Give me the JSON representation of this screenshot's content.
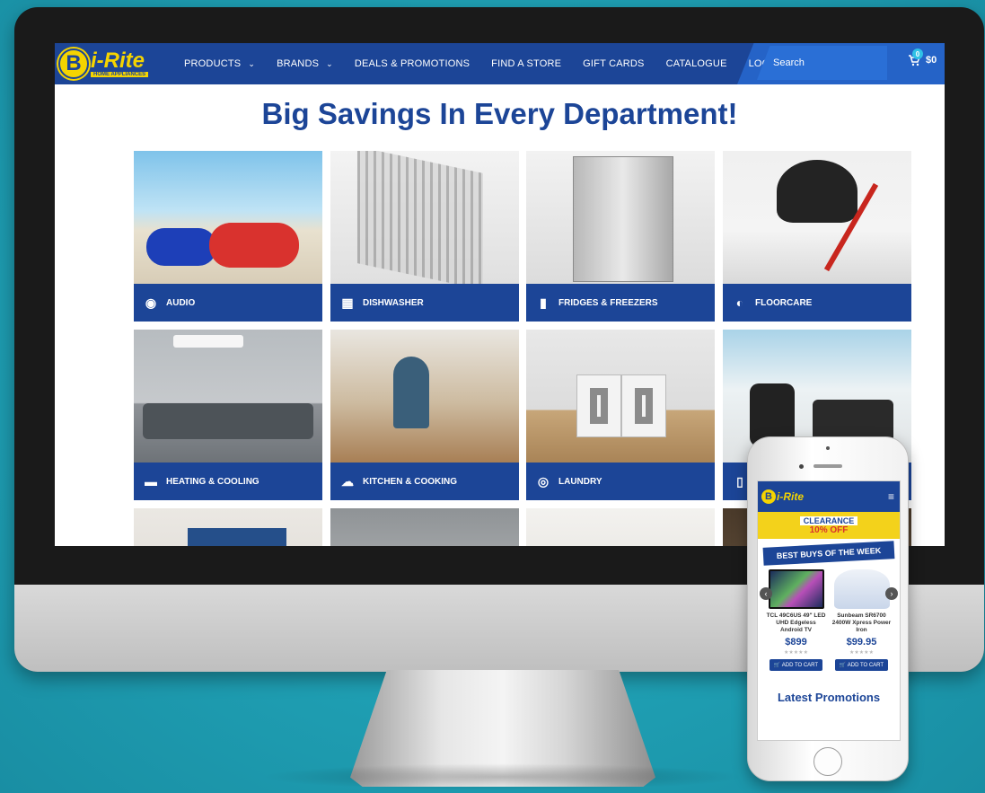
{
  "site": {
    "logo_letter": "B",
    "logo_text": "i-Rite",
    "logo_sub": "HOME APPLIANCES"
  },
  "nav": {
    "items": [
      {
        "label": "PRODUCTS",
        "dropdown": true
      },
      {
        "label": "BRANDS",
        "dropdown": true
      },
      {
        "label": "DEALS & PROMOTIONS",
        "dropdown": false
      },
      {
        "label": "FIND A STORE",
        "dropdown": false
      },
      {
        "label": "GIFT CARDS",
        "dropdown": false
      },
      {
        "label": "CATALOGUE",
        "dropdown": false
      },
      {
        "label": "LOGIN",
        "dropdown": false
      }
    ],
    "search_placeholder": "Search",
    "cart_count": "0",
    "cart_total": "$0"
  },
  "main": {
    "title": "Big Savings In Every Department!",
    "categories": [
      {
        "label": "AUDIO",
        "icon": "speaker-icon",
        "glyph": "◉"
      },
      {
        "label": "DISHWASHER",
        "icon": "dishwasher-icon",
        "glyph": "▦"
      },
      {
        "label": "FRIDGES & FREEZERS",
        "icon": "fridge-icon",
        "glyph": "▮"
      },
      {
        "label": "FLOORCARE",
        "icon": "vacuum-icon",
        "glyph": "◐"
      },
      {
        "label": "HEATING & COOLING",
        "icon": "air-conditioner-icon",
        "glyph": "▬"
      },
      {
        "label": "KITCHEN & COOKING",
        "icon": "chef-hat-icon",
        "glyph": "☁"
      },
      {
        "label": "LAUNDRY",
        "icon": "washing-machine-icon",
        "glyph": "◎"
      },
      {
        "label": "",
        "icon": "blender-icon",
        "glyph": "▯"
      }
    ]
  },
  "mobile": {
    "banner_line1": "CLEARANCE",
    "banner_line2": "10% OFF",
    "section_title": "BEST BUYS OF THE WEEK",
    "products": [
      {
        "name": "TCL 49C6US 49\" LED UHD Edgeless Android TV",
        "price": "$899",
        "button": "ADD TO CART"
      },
      {
        "name": "Sunbeam SR6700 2400W Xpress Power Iron",
        "price": "$99.95",
        "button": "ADD TO CART"
      }
    ],
    "latest_title": "Latest Promotions"
  },
  "colors": {
    "brand_blue": "#1c4597",
    "brand_yellow": "#f5d400",
    "background_teal": "#1f9fb3"
  }
}
